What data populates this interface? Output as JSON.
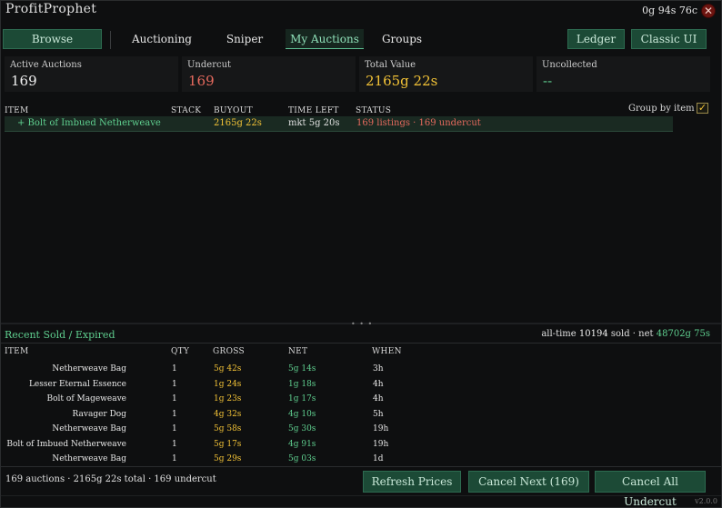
{
  "app": {
    "title": "ProfitProphet",
    "gold": "0g 94s 76c",
    "version": "v2.0.0"
  },
  "tabs": {
    "browse": "Browse",
    "auctioning": "Auctioning",
    "sniper": "Sniper",
    "my_auctions": "My Auctions",
    "groups": "Groups",
    "ledger": "Ledger",
    "classic_ui": "Classic UI"
  },
  "stats": {
    "active": {
      "label": "Active Auctions",
      "value": "169"
    },
    "undercut": {
      "label": "Undercut",
      "value": "169"
    },
    "total": {
      "label": "Total Value",
      "value": "2165g 22s"
    },
    "uncollected": {
      "label": "Uncollected",
      "value": "--"
    }
  },
  "auctions": {
    "headers": {
      "item": "ITEM",
      "stack": "STACK",
      "buyout": "BUYOUT",
      "time_left": "TIME LEFT",
      "status": "STATUS"
    },
    "group_by_label": "Group by item",
    "group_by_checked": true,
    "rows": [
      {
        "item": "+ Bolt of Imbued Netherweave",
        "buyout": "2165g 22s",
        "time_left": "mkt 5g 20s",
        "status": "169 listings · 169 undercut"
      }
    ]
  },
  "recent": {
    "title": "Recent Sold / Expired",
    "summary_prefix": "all-time",
    "sold_count": "10194",
    "sold_suffix": "sold ·",
    "net_label": "net",
    "net_value": "48702g 75s",
    "headers": {
      "item": "ITEM",
      "qty": "QTY",
      "gross": "GROSS",
      "net": "NET",
      "when": "WHEN"
    },
    "rows": [
      {
        "item": "Netherweave Bag",
        "qty": "1",
        "gross": "5g 42s",
        "net": "5g 14s",
        "when": "3h"
      },
      {
        "item": "Lesser Eternal Essence",
        "qty": "1",
        "gross": "1g 24s",
        "net": "1g 18s",
        "when": "4h"
      },
      {
        "item": "Bolt of Mageweave",
        "qty": "1",
        "gross": "1g 23s",
        "net": "1g 17s",
        "when": "4h"
      },
      {
        "item": "Ravager Dog",
        "qty": "1",
        "gross": "4g 32s",
        "net": "4g 10s",
        "when": "5h"
      },
      {
        "item": "Netherweave Bag",
        "qty": "1",
        "gross": "5g 58s",
        "net": "5g 30s",
        "when": "19h"
      },
      {
        "item": "Bolt of Imbued Netherweave",
        "qty": "1",
        "gross": "5g 17s",
        "net": "4g 91s",
        "when": "19h"
      },
      {
        "item": "Netherweave Bag",
        "qty": "1",
        "gross": "5g 29s",
        "net": "5g 03s",
        "when": "1d"
      }
    ]
  },
  "footer": {
    "summary": "169 auctions · 2165g 22s total · 169 undercut",
    "refresh": "Refresh Prices",
    "cancel_next": "Cancel Next (169)",
    "cancel_all": "Cancel All Undercut"
  },
  "colors": {
    "accent_green": "#5fcf8f",
    "gold": "#f2c236",
    "red": "#e76a5e",
    "button_bg": "#1c4a36"
  }
}
